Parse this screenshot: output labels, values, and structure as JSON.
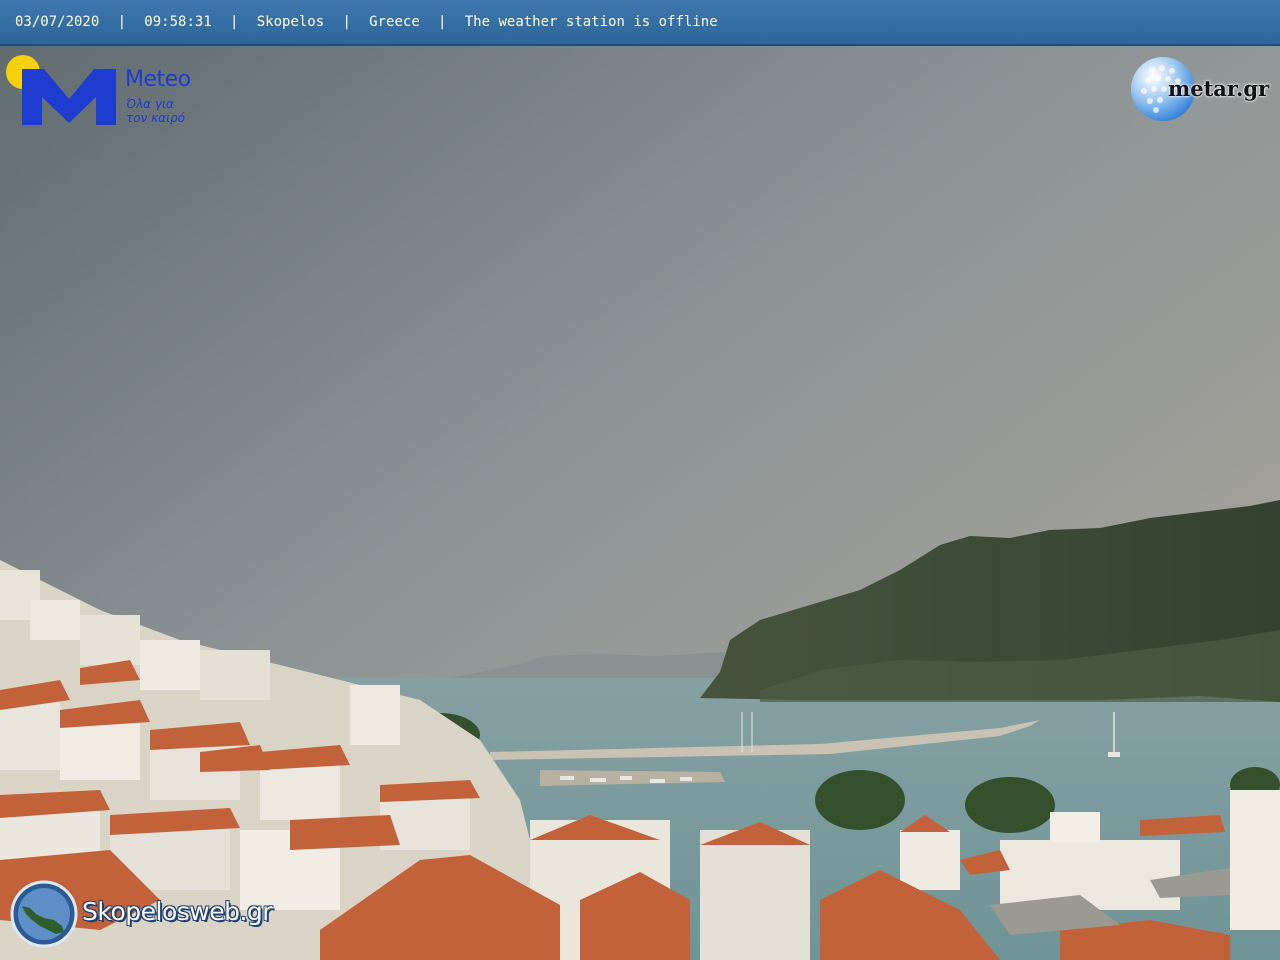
{
  "overlay": {
    "date": "03/07/2020",
    "time": "09:58:31",
    "location": "Skopelos",
    "country": "Greece",
    "status": "The weather station is offline",
    "separator": "|"
  },
  "logos": {
    "meteo": {
      "name": "Meteo",
      "tagline_line1": "Όλα για",
      "tagline_line2": "τον καιρό",
      "sun_color": "#f4d10b",
      "brand_color": "#1e3ccf"
    },
    "metar": {
      "name": "metar.gr",
      "icon": "golf-ball-globe-icon"
    },
    "skopelosweb": {
      "name": "Skopelosweb.gr",
      "icon": "island-map-icon"
    }
  },
  "scene": {
    "sky_color": "#8d9496",
    "sea_color": "#7a9a9c",
    "mountain_color": "#3f4d36",
    "roof_color": "#c2623a",
    "house_color": "#e6e2d8"
  }
}
